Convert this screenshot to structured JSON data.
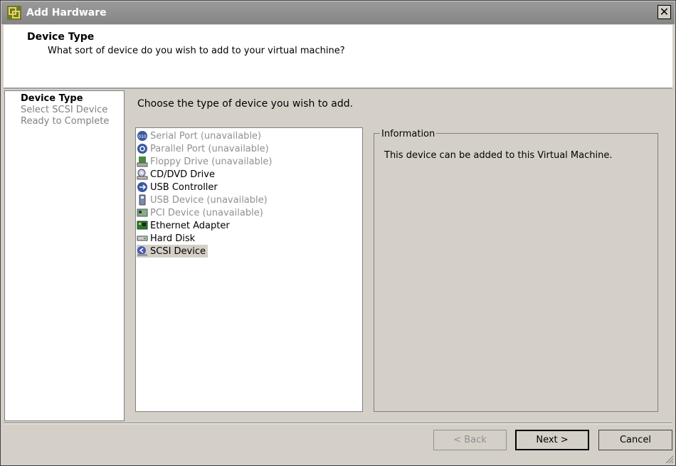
{
  "window": {
    "title": "Add Hardware",
    "close_glyph": "✕"
  },
  "header": {
    "title": "Device Type",
    "subtitle": "What sort of device do you wish to add to your virtual machine?"
  },
  "steps": [
    {
      "label": "Device Type",
      "active": true
    },
    {
      "label": "Select SCSI Device",
      "active": false
    },
    {
      "label": "Ready to Complete",
      "active": false
    }
  ],
  "instruction": "Choose the type of device you wish to add.",
  "devices": [
    {
      "label": "Serial Port (unavailable)",
      "icon": "serial-port-icon",
      "available": false
    },
    {
      "label": "Parallel Port (unavailable)",
      "icon": "parallel-port-icon",
      "available": false
    },
    {
      "label": "Floppy Drive (unavailable)",
      "icon": "floppy-drive-icon",
      "available": false
    },
    {
      "label": "CD/DVD Drive",
      "icon": "cd-dvd-drive-icon",
      "available": true
    },
    {
      "label": "USB Controller",
      "icon": "usb-controller-icon",
      "available": true
    },
    {
      "label": "USB Device (unavailable)",
      "icon": "usb-device-icon",
      "available": false
    },
    {
      "label": "PCI Device (unavailable)",
      "icon": "pci-device-icon",
      "available": false
    },
    {
      "label": "Ethernet Adapter",
      "icon": "ethernet-adapter-icon",
      "available": true
    },
    {
      "label": "Hard Disk",
      "icon": "hard-disk-icon",
      "available": true
    },
    {
      "label": "SCSI Device",
      "icon": "scsi-device-icon",
      "available": true,
      "selected": true
    }
  ],
  "info": {
    "legend": "Information",
    "text": "This device can be added to this Virtual Machine."
  },
  "buttons": {
    "back": "< Back",
    "next": "Next >",
    "cancel": "Cancel"
  }
}
